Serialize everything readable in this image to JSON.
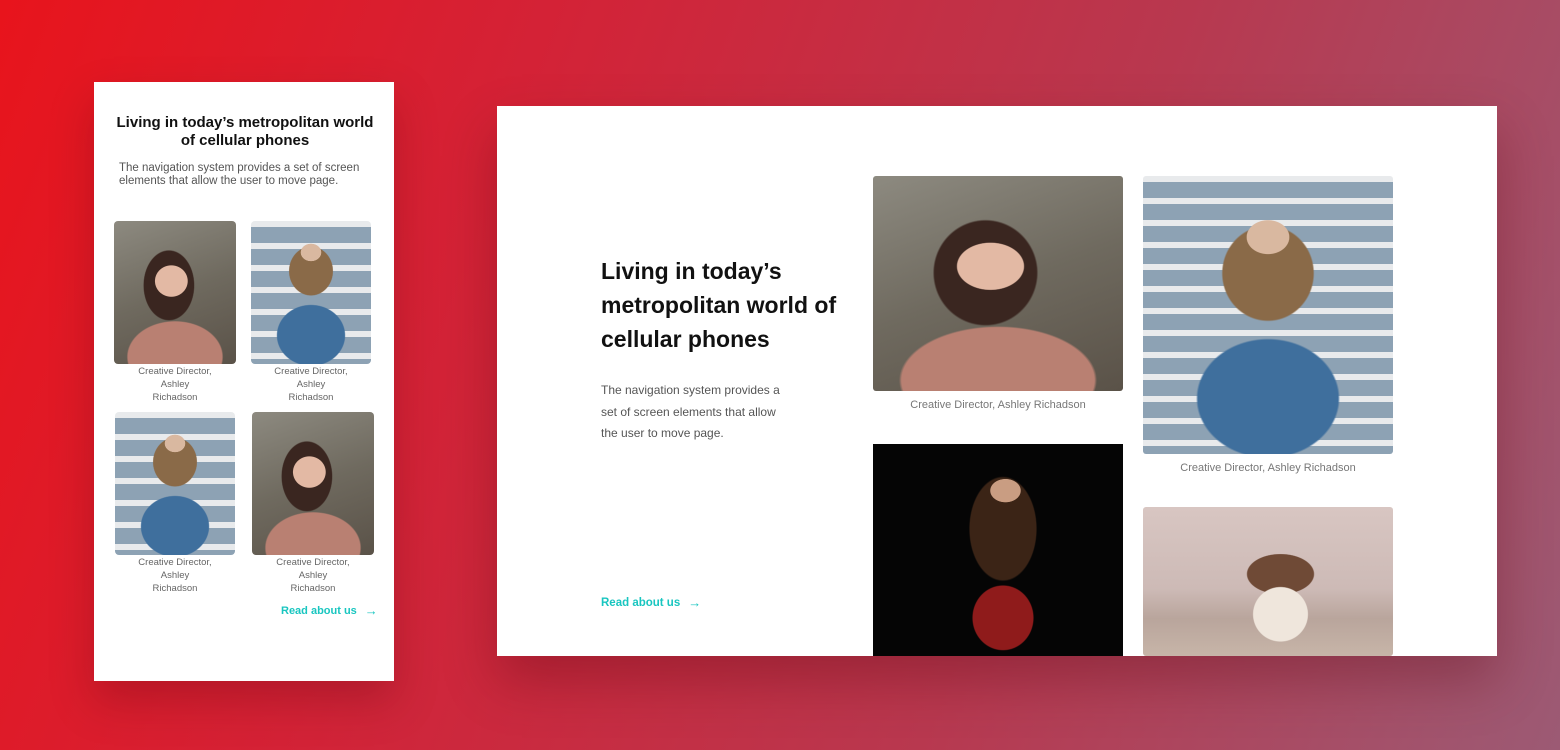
{
  "mobile": {
    "title": "Living in today’s metropolitan world of cellular phones",
    "description": "The navigation system provides a set of screen elements that allow the user to move page.",
    "cards": [
      {
        "caption_lines": [
          "Creative Director,",
          "Ashley",
          "Richadson"
        ],
        "photo": "woman-pink-sweater"
      },
      {
        "caption_lines": [
          "Creative Director,",
          "Ashley",
          "Richadson"
        ],
        "photo": "woman-sunglasses-stairs"
      },
      {
        "caption_lines": [
          "Creative Director,",
          "Ashley",
          "Richadson"
        ],
        "photo": "woman-sunglasses-stairs"
      },
      {
        "caption_lines": [
          "Creative Director,",
          "Ashley",
          "Richadson"
        ],
        "photo": "woman-pink-sweater"
      }
    ],
    "link_label": "Read about us",
    "link_arrow": "→"
  },
  "desktop": {
    "title": "Living in today’s metropolitan world of cellular phones",
    "description": "The navigation system provides a set of screen elements that allow the user to move page.",
    "cards": [
      {
        "caption": "Creative Director, Ashley Richadson",
        "photo": "woman-pink-sweater"
      },
      {
        "caption": "Creative Director, Ashley Richadson",
        "photo": "woman-sunglasses-stairs"
      },
      {
        "caption": "",
        "photo": "woman-dark-background"
      },
      {
        "caption": "",
        "photo": "woman-beach"
      }
    ],
    "link_label": "Read about us",
    "link_arrow": "→"
  },
  "colors": {
    "accent": "#19c6c0",
    "background_start": "#e8141c",
    "background_end": "#9c5a74"
  }
}
